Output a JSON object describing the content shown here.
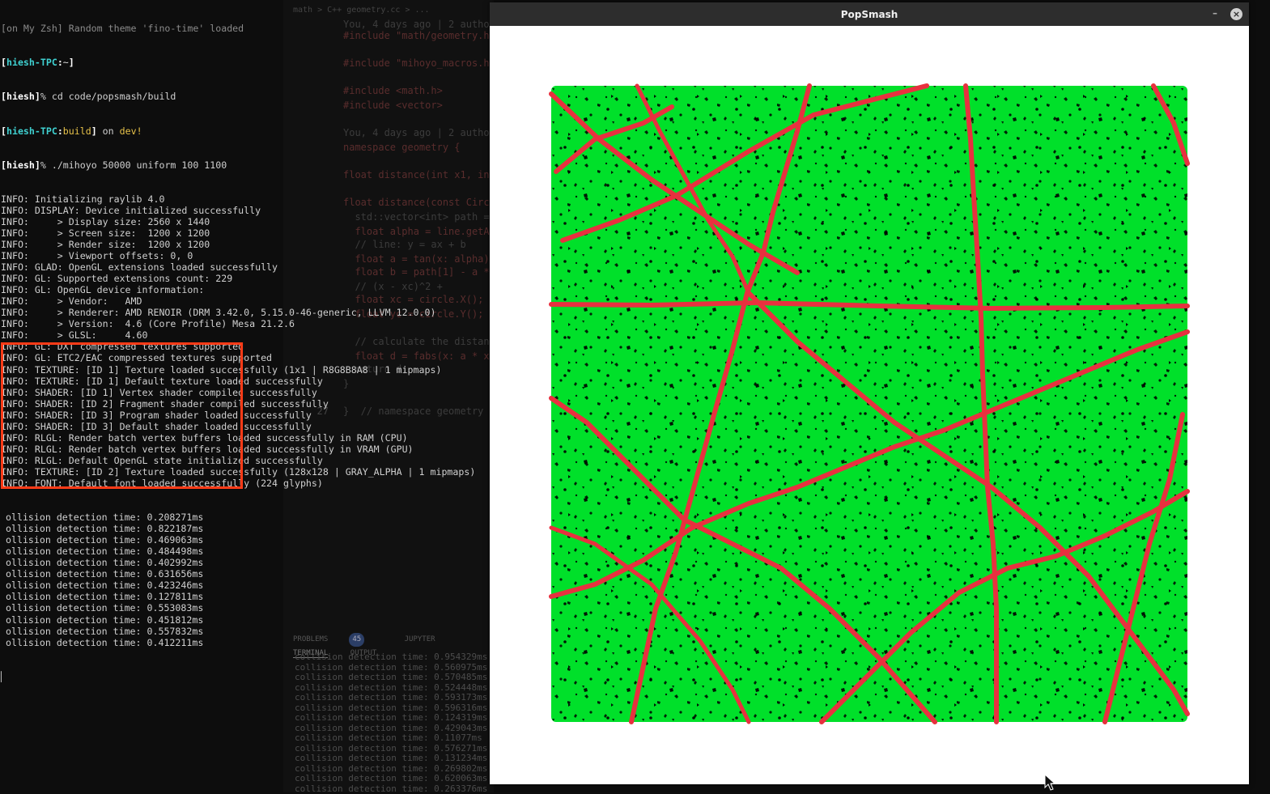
{
  "editor_ghost": {
    "breadcrumb": "math > C++ geometry.cc > ...",
    "lines": [
      {
        "ln": "",
        "text": "You, 4 days ago | 2 authors (hieshx)"
      },
      {
        "ln": "",
        "text": "#include \"math/geometry.h\""
      },
      {
        "ln": "",
        "text": "#include \"mihoyo_macros.h\""
      },
      {
        "ln": "",
        "text": "#include <math.h>"
      },
      {
        "ln": "",
        "text": "#include <vector>"
      },
      {
        "ln": "",
        "text": "You, 4 days ago | 2 authors (hieshx)"
      },
      {
        "ln": "",
        "text": "namespace geometry {"
      },
      {
        "ln": "",
        "text": "float distance(int x1, int"
      },
      {
        "ln": "",
        "text": "float distance(const Circl"
      },
      {
        "ln": "",
        "text": "  std::vector<int> path ="
      },
      {
        "ln": "",
        "text": "  float alpha = line.getAl"
      },
      {
        "ln": "",
        "text": "  // line: y = ax + b"
      },
      {
        "ln": "",
        "text": "  float a = tan(x: alpha);"
      },
      {
        "ln": "",
        "text": "  float b = path[1] - a *"
      },
      {
        "ln": "",
        "text": "  // (x - xc)^2 +"
      },
      {
        "ln": "",
        "text": "  float xc = circle.X();"
      },
      {
        "ln": "",
        "text": "  float yc = circle.Y();"
      },
      {
        "ln": "",
        "text": "  // calculate the distanc"
      },
      {
        "ln": "",
        "text": "  float d = fabs(x: a * xc"
      },
      {
        "ln": "",
        "text": "  return d;"
      },
      {
        "ln": "",
        "text": "}"
      },
      {
        "ln": "27",
        "text": "}  // namespace geometry"
      }
    ],
    "panel_tabs": [
      "PROBLEMS",
      "JUPYTER",
      "TERMINAL",
      "OUTPUT"
    ],
    "problems_count": "45",
    "terminal_lines": [
      "collision detection time: 0.954329ms",
      "collision detection time: 0.560975ms",
      "collision detection time: 0.570485ms",
      "collision detection time: 0.524448ms",
      "collision detection time: 0.593173ms",
      "collision detection time: 0.596316ms",
      "collision detection time: 0.124319ms",
      "collision detection time: 0.429043ms",
      "collision detection time: 0.11077ms",
      "collision detection time: 0.576271ms",
      "collision detection time: 0.131234ms",
      "collision detection time: 0.269802ms",
      "collision detection time: 0.620063ms",
      "collision detection time: 0.263376ms"
    ]
  },
  "terminal": {
    "top_line": "[on My Zsh] Random theme 'fino-time' loaded",
    "prompt1": {
      "user": "hiesh-TPC",
      "dir": "~"
    },
    "cmd1": "cd code/popsmash/build",
    "prompt2": {
      "user": "hiesh-TPC",
      "dir": "build",
      "on": "on",
      "branch": "dev!"
    },
    "cmd2": "./mihoyo 50000 uniform 100 1100",
    "info_lines": [
      "INFO: Initializing raylib 4.0",
      "INFO: DISPLAY: Device initialized successfully",
      "INFO:     > Display size: 2560 x 1440",
      "INFO:     > Screen size:  1200 x 1200",
      "INFO:     > Render size:  1200 x 1200",
      "INFO:     > Viewport offsets: 0, 0",
      "INFO: GLAD: OpenGL extensions loaded successfully",
      "INFO: GL: Supported extensions count: 229",
      "INFO: GL: OpenGL device information:",
      "INFO:     > Vendor:   AMD",
      "INFO:     > Renderer: AMD RENOIR (DRM 3.42.0, 5.15.0-46-generic, LLVM 12.0.0)",
      "INFO:     > Version:  4.6 (Core Profile) Mesa 21.2.6",
      "INFO:     > GLSL:     4.60",
      "INFO: GL: DXT compressed textures supported",
      "INFO: GL: ETC2/EAC compressed textures supported",
      "INFO: TEXTURE: [ID 1] Texture loaded successfully (1x1 | R8G8B8A8 | 1 mipmaps)",
      "INFO: TEXTURE: [ID 1] Default texture loaded successfully",
      "INFO: SHADER: [ID 1] Vertex shader compiled successfully",
      "INFO: SHADER: [ID 2] Fragment shader compiled successfully",
      "INFO: SHADER: [ID 3] Program shader loaded successfully",
      "INFO: SHADER: [ID 3] Default shader loaded successfully",
      "INFO: RLGL: Render batch vertex buffers loaded successfully in RAM (CPU)",
      "INFO: RLGL: Render batch vertex buffers loaded successfully in VRAM (GPU)",
      "INFO: RLGL: Default OpenGL state initialized successfully",
      "INFO: TEXTURE: [ID 2] Texture loaded successfully (128x128 | GRAY_ALPHA | 1 mipmaps)",
      "INFO: FONT: Default font loaded successfully (224 glyphs)"
    ],
    "collision_lines": [
      "ollision detection time: 0.208271ms",
      "ollision detection time: 0.822187ms",
      "ollision detection time: 0.469063ms",
      "ollision detection time: 0.484498ms",
      "ollision detection time: 0.402992ms",
      "ollision detection time: 0.631656ms",
      "ollision detection time: 0.423246ms",
      "ollision detection time: 0.127811ms",
      "ollision detection time: 0.553083ms",
      "ollision detection time: 0.451812ms",
      "ollision detection time: 0.557832ms",
      "ollision detection time: 0.412211ms"
    ]
  },
  "window": {
    "title": "PopSmash",
    "minimize_glyph": "–",
    "close_glyph": "×"
  },
  "colors": {
    "particle": "#00e02a",
    "collision": "#e8313f",
    "hole": "#000000",
    "highlight_box": "#ff3b17",
    "canvas_bg": "#ffffff"
  }
}
